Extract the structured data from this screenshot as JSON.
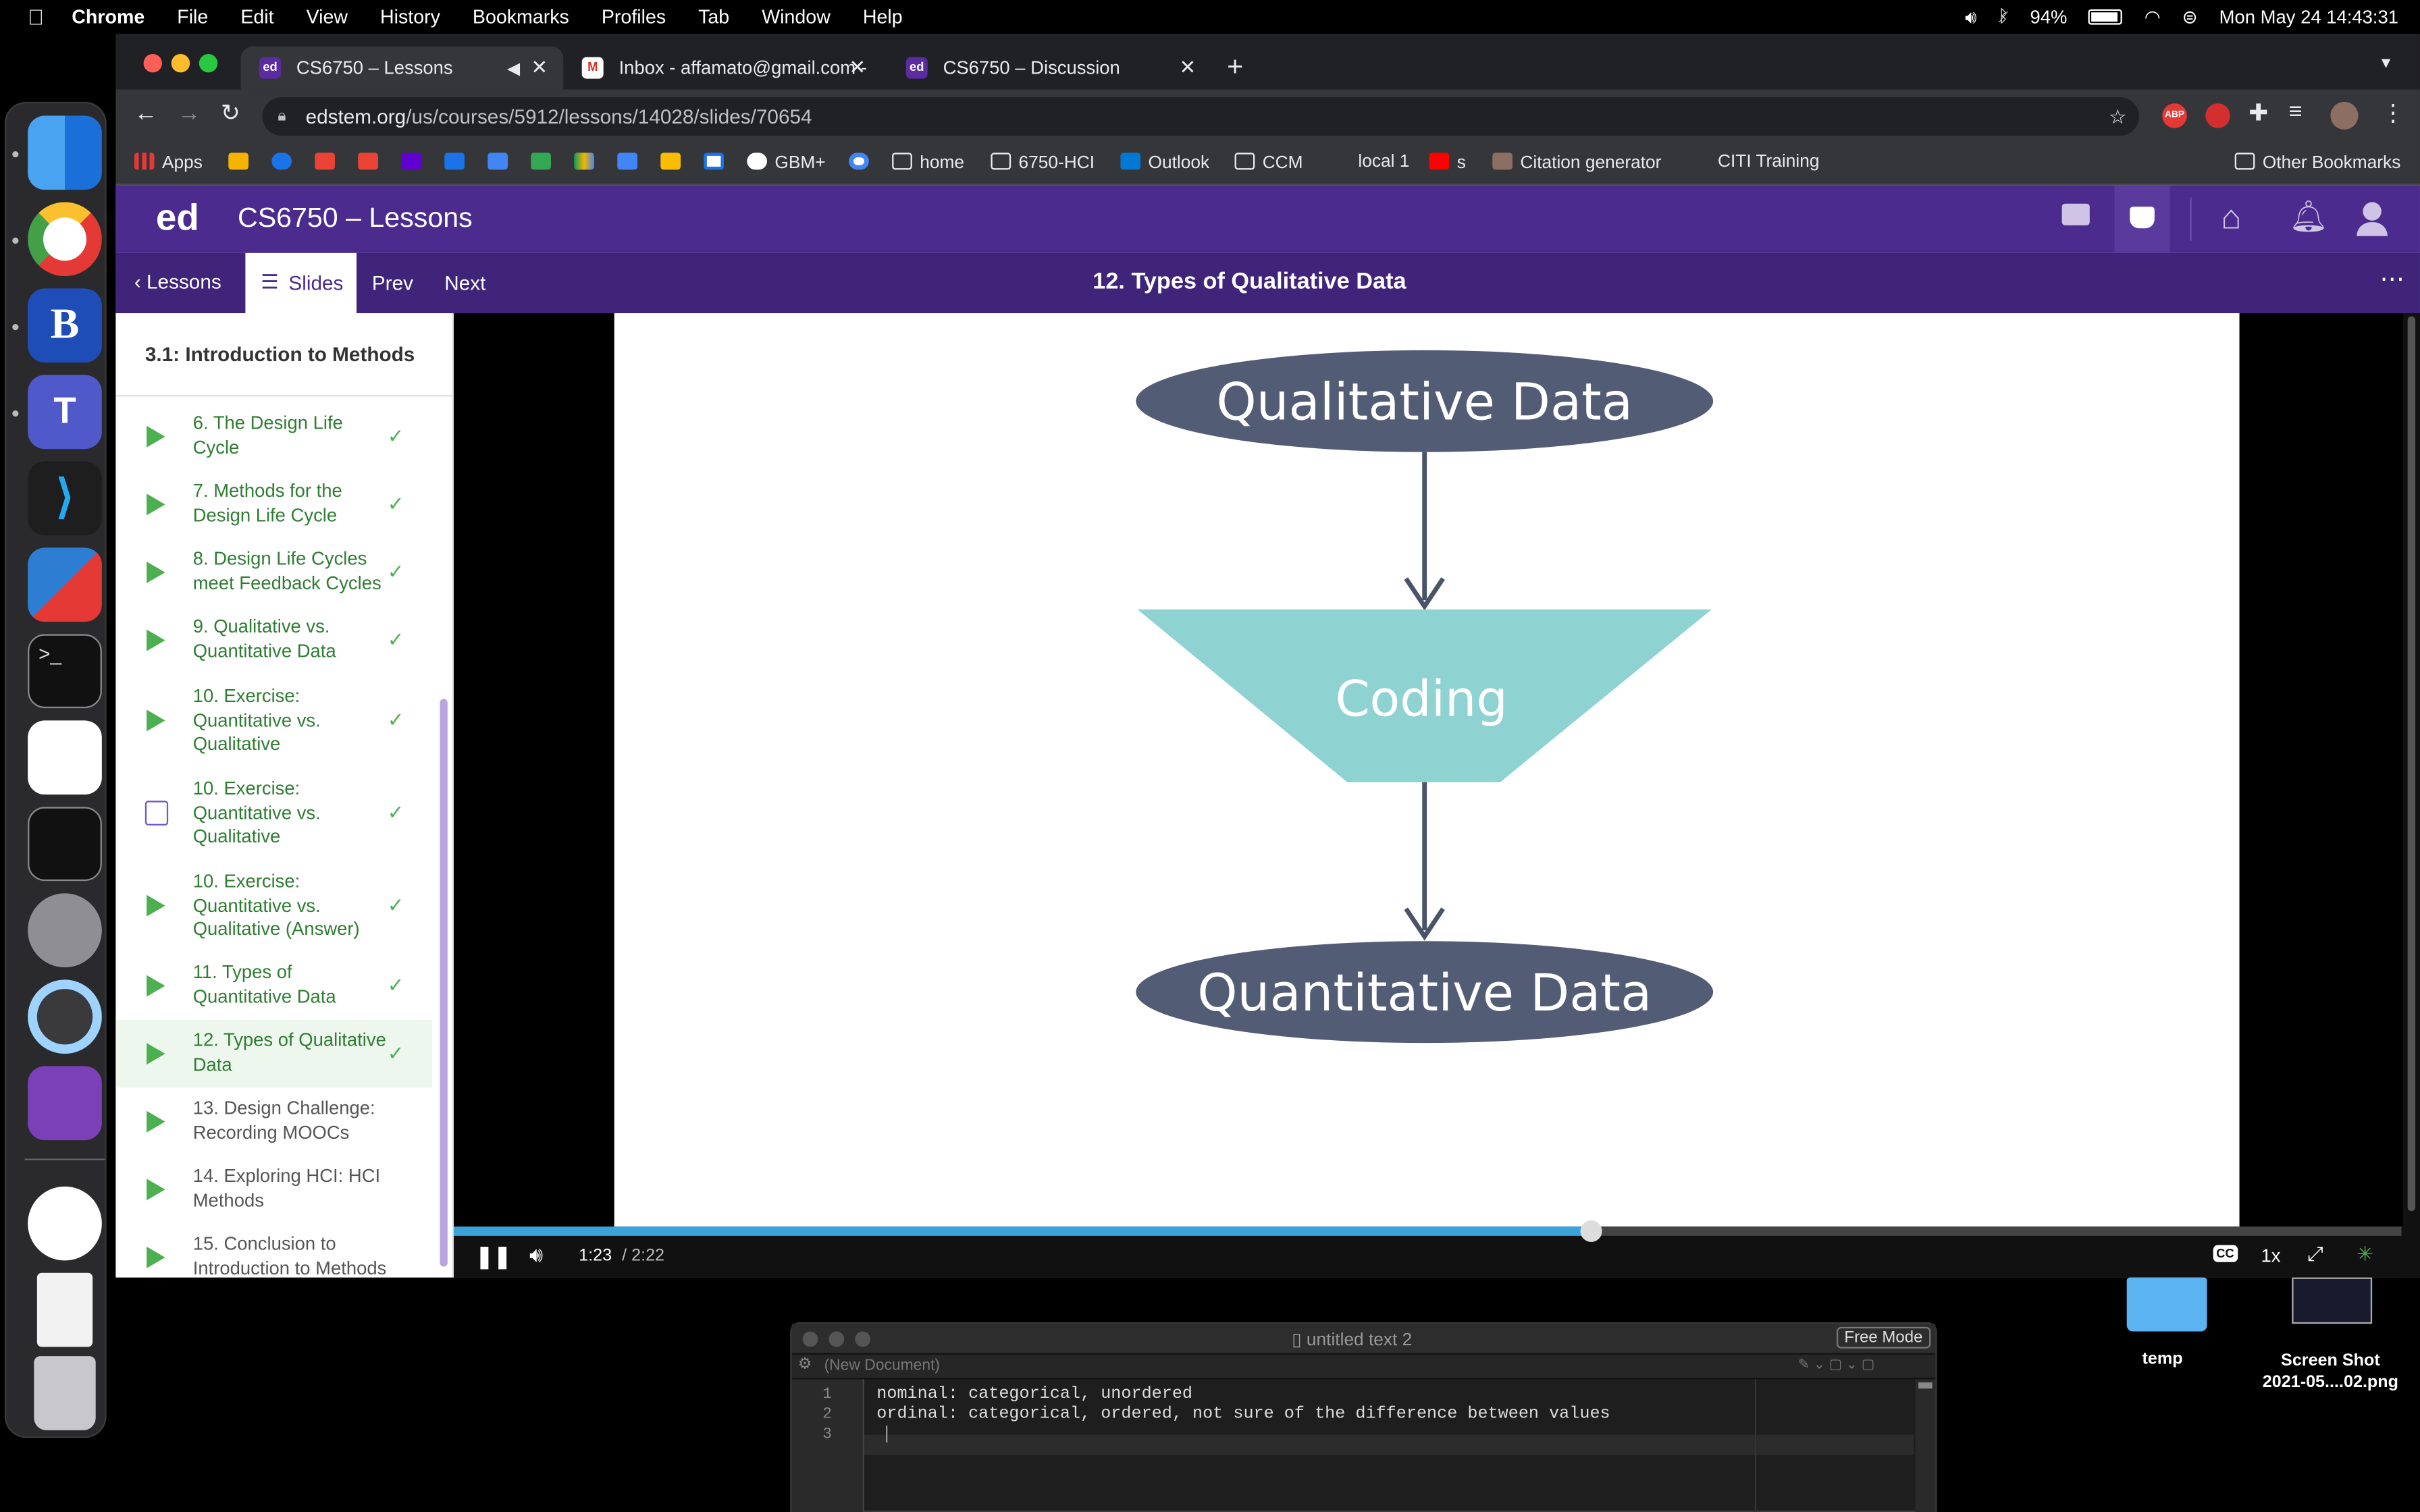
{
  "menubar": {
    "app": "Chrome",
    "items": [
      "File",
      "Edit",
      "View",
      "History",
      "Bookmarks",
      "Profiles",
      "Tab",
      "Window",
      "Help"
    ],
    "battery": "94%",
    "clock": "Mon May 24  14:43:31"
  },
  "tabs": [
    {
      "title": "CS6750 – Lessons",
      "active": true
    },
    {
      "title": "Inbox - affamato@gmail.com -",
      "active": false
    },
    {
      "title": "CS6750 – Discussion",
      "active": false
    }
  ],
  "address": {
    "domain": "edstem.org",
    "path": "/us/courses/5912/lessons/14028/slides/70654"
  },
  "bookmarks": {
    "apps": "Apps",
    "gbm": "GBM+",
    "home": "home",
    "hci": "6750-HCI",
    "outlook": "Outlook",
    "ccm": "CCM",
    "local": "local 1",
    "s": "s",
    "citation": "Citation generator",
    "citi": "CITI Training",
    "other": "Other Bookmarks"
  },
  "ed": {
    "logo": "ed",
    "course_title": "CS6750 – Lessons",
    "nav": {
      "lessons": "Lessons",
      "slides": "Slides",
      "prev": "Prev",
      "next": "Next"
    },
    "slide_title": "12. Types of Qualitative Data",
    "lesson_heading": "3.1: Introduction to Methods"
  },
  "lesson_items": [
    {
      "label": "6. The Design Life Cycle",
      "type": "video",
      "done": true
    },
    {
      "label": "7. Methods for the Design Life Cycle",
      "type": "video",
      "done": true
    },
    {
      "label": "8. Design Life Cycles meet Feedback Cycles",
      "type": "video",
      "done": true
    },
    {
      "label": "9. Qualitative vs. Quantitative Data",
      "type": "video",
      "done": true
    },
    {
      "label": "10. Exercise: Quantitative vs. Qualitative",
      "type": "video",
      "done": true
    },
    {
      "label": "10. Exercise: Quantitative vs. Qualitative",
      "type": "quiz",
      "done": true
    },
    {
      "label": "10. Exercise: Quantitative vs. Qualitative (Answer)",
      "type": "video",
      "done": true
    },
    {
      "label": "11. Types of Quantitative Data",
      "type": "video",
      "done": true
    },
    {
      "label": "12. Types of Qualitative Data",
      "type": "video",
      "done": true,
      "active": true
    },
    {
      "label": "13. Design Challenge: Recording MOOCs",
      "type": "video",
      "done": false
    },
    {
      "label": "14. Exploring HCI: HCI Methods",
      "type": "video",
      "done": false
    },
    {
      "label": "15. Conclusion to Introduction to Methods",
      "type": "video",
      "done": false
    }
  ],
  "diagram": {
    "top": "Qualitative Data",
    "middle": "Coding",
    "bottom": "Quantitative Data",
    "colors": {
      "ellipse": "#525c74",
      "trapezoid": "#8ed2d2",
      "arrow": "#4a5468"
    }
  },
  "player": {
    "current": "1:23",
    "duration": "/ 2:22",
    "progress": 0.584,
    "speed": "1x",
    "cc": "CC"
  },
  "textedit": {
    "title": "untitled text 2",
    "mode": "Free Mode",
    "doc_status": "(New Document)",
    "lines": [
      "nominal: categorical, unordered",
      "ordinal: categorical, ordered, not sure of the difference between values",
      ""
    ]
  },
  "desktop": {
    "folder": "temp",
    "screenshot": "Screen Shot\n2021-05....02.png"
  }
}
